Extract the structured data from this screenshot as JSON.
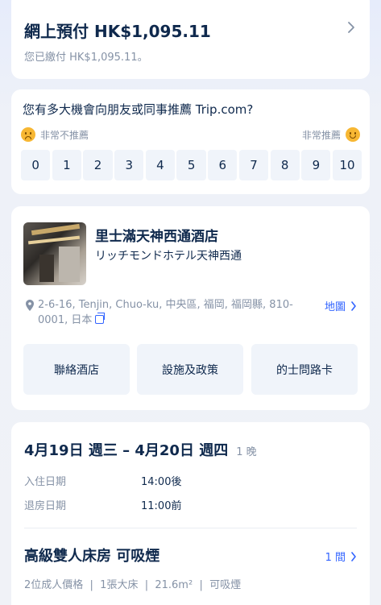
{
  "payment": {
    "title": "網上預付 HK$1,095.11",
    "subtitle": "您已繳付 HK$1,095.11。"
  },
  "nps": {
    "question": "您有多大機會向朋友或同事推薦 Trip.com?",
    "left_label": "非常不推薦",
    "right_label": "非常推薦",
    "scores": [
      "0",
      "1",
      "2",
      "3",
      "4",
      "5",
      "6",
      "7",
      "8",
      "9",
      "10"
    ]
  },
  "hotel": {
    "name": "里士滿天神西通酒店",
    "name_jp": "リッチモンドホテル天神西通",
    "address": "2-6-16, Tenjin, Chuo-ku, 中央區, 福岡, 福岡縣, 810-0001, 日本",
    "map_label": "地圖",
    "buttons": [
      "聯絡酒店",
      "設施及政策",
      "的士問路卡"
    ]
  },
  "stay": {
    "dates": "4月19日 週三 – 4月20日 週四",
    "nights": "1 晚",
    "checkin_label": "入住日期",
    "checkin_value": "14:00後",
    "checkout_label": "退房日期",
    "checkout_value": "11:00前",
    "room_name": "高級雙人床房 可吸煙",
    "room_count": "1 間",
    "room_spec": "2位成人價格  |  1張大床  |  21.6m²  |  可吸煙"
  },
  "colors": {
    "accent": "#3264ff",
    "text_primary": "#0f294d",
    "text_secondary": "#8592a6",
    "button_bg": "#f0f4fa"
  }
}
